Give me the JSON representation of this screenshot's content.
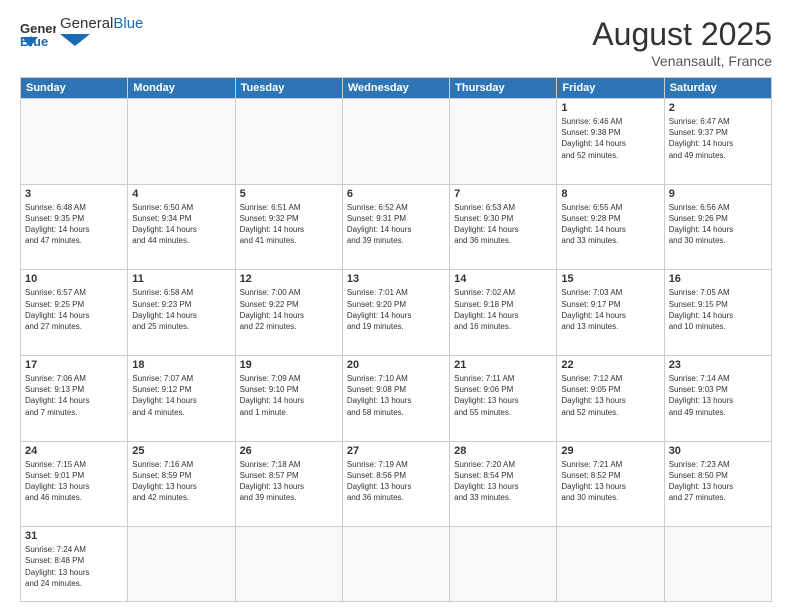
{
  "header": {
    "logo_general": "General",
    "logo_blue": "Blue",
    "month_year": "August 2025",
    "location": "Venansault, France"
  },
  "weekdays": [
    "Sunday",
    "Monday",
    "Tuesday",
    "Wednesday",
    "Thursday",
    "Friday",
    "Saturday"
  ],
  "weeks": [
    [
      {
        "day": "",
        "text": ""
      },
      {
        "day": "",
        "text": ""
      },
      {
        "day": "",
        "text": ""
      },
      {
        "day": "",
        "text": ""
      },
      {
        "day": "",
        "text": ""
      },
      {
        "day": "1",
        "text": "Sunrise: 6:46 AM\nSunset: 9:38 PM\nDaylight: 14 hours\nand 52 minutes."
      },
      {
        "day": "2",
        "text": "Sunrise: 6:47 AM\nSunset: 9:37 PM\nDaylight: 14 hours\nand 49 minutes."
      }
    ],
    [
      {
        "day": "3",
        "text": "Sunrise: 6:48 AM\nSunset: 9:35 PM\nDaylight: 14 hours\nand 47 minutes."
      },
      {
        "day": "4",
        "text": "Sunrise: 6:50 AM\nSunset: 9:34 PM\nDaylight: 14 hours\nand 44 minutes."
      },
      {
        "day": "5",
        "text": "Sunrise: 6:51 AM\nSunset: 9:32 PM\nDaylight: 14 hours\nand 41 minutes."
      },
      {
        "day": "6",
        "text": "Sunrise: 6:52 AM\nSunset: 9:31 PM\nDaylight: 14 hours\nand 39 minutes."
      },
      {
        "day": "7",
        "text": "Sunrise: 6:53 AM\nSunset: 9:30 PM\nDaylight: 14 hours\nand 36 minutes."
      },
      {
        "day": "8",
        "text": "Sunrise: 6:55 AM\nSunset: 9:28 PM\nDaylight: 14 hours\nand 33 minutes."
      },
      {
        "day": "9",
        "text": "Sunrise: 6:56 AM\nSunset: 9:26 PM\nDaylight: 14 hours\nand 30 minutes."
      }
    ],
    [
      {
        "day": "10",
        "text": "Sunrise: 6:57 AM\nSunset: 9:25 PM\nDaylight: 14 hours\nand 27 minutes."
      },
      {
        "day": "11",
        "text": "Sunrise: 6:58 AM\nSunset: 9:23 PM\nDaylight: 14 hours\nand 25 minutes."
      },
      {
        "day": "12",
        "text": "Sunrise: 7:00 AM\nSunset: 9:22 PM\nDaylight: 14 hours\nand 22 minutes."
      },
      {
        "day": "13",
        "text": "Sunrise: 7:01 AM\nSunset: 9:20 PM\nDaylight: 14 hours\nand 19 minutes."
      },
      {
        "day": "14",
        "text": "Sunrise: 7:02 AM\nSunset: 9:18 PM\nDaylight: 14 hours\nand 16 minutes."
      },
      {
        "day": "15",
        "text": "Sunrise: 7:03 AM\nSunset: 9:17 PM\nDaylight: 14 hours\nand 13 minutes."
      },
      {
        "day": "16",
        "text": "Sunrise: 7:05 AM\nSunset: 9:15 PM\nDaylight: 14 hours\nand 10 minutes."
      }
    ],
    [
      {
        "day": "17",
        "text": "Sunrise: 7:06 AM\nSunset: 9:13 PM\nDaylight: 14 hours\nand 7 minutes."
      },
      {
        "day": "18",
        "text": "Sunrise: 7:07 AM\nSunset: 9:12 PM\nDaylight: 14 hours\nand 4 minutes."
      },
      {
        "day": "19",
        "text": "Sunrise: 7:09 AM\nSunset: 9:10 PM\nDaylight: 14 hours\nand 1 minute."
      },
      {
        "day": "20",
        "text": "Sunrise: 7:10 AM\nSunset: 9:08 PM\nDaylight: 13 hours\nand 58 minutes."
      },
      {
        "day": "21",
        "text": "Sunrise: 7:11 AM\nSunset: 9:06 PM\nDaylight: 13 hours\nand 55 minutes."
      },
      {
        "day": "22",
        "text": "Sunrise: 7:12 AM\nSunset: 9:05 PM\nDaylight: 13 hours\nand 52 minutes."
      },
      {
        "day": "23",
        "text": "Sunrise: 7:14 AM\nSunset: 9:03 PM\nDaylight: 13 hours\nand 49 minutes."
      }
    ],
    [
      {
        "day": "24",
        "text": "Sunrise: 7:15 AM\nSunset: 9:01 PM\nDaylight: 13 hours\nand 46 minutes."
      },
      {
        "day": "25",
        "text": "Sunrise: 7:16 AM\nSunset: 8:59 PM\nDaylight: 13 hours\nand 42 minutes."
      },
      {
        "day": "26",
        "text": "Sunrise: 7:18 AM\nSunset: 8:57 PM\nDaylight: 13 hours\nand 39 minutes."
      },
      {
        "day": "27",
        "text": "Sunrise: 7:19 AM\nSunset: 8:56 PM\nDaylight: 13 hours\nand 36 minutes."
      },
      {
        "day": "28",
        "text": "Sunrise: 7:20 AM\nSunset: 8:54 PM\nDaylight: 13 hours\nand 33 minutes."
      },
      {
        "day": "29",
        "text": "Sunrise: 7:21 AM\nSunset: 8:52 PM\nDaylight: 13 hours\nand 30 minutes."
      },
      {
        "day": "30",
        "text": "Sunrise: 7:23 AM\nSunset: 8:50 PM\nDaylight: 13 hours\nand 27 minutes."
      }
    ],
    [
      {
        "day": "31",
        "text": "Sunrise: 7:24 AM\nSunset: 8:48 PM\nDaylight: 13 hours\nand 24 minutes."
      },
      {
        "day": "",
        "text": ""
      },
      {
        "day": "",
        "text": ""
      },
      {
        "day": "",
        "text": ""
      },
      {
        "day": "",
        "text": ""
      },
      {
        "day": "",
        "text": ""
      },
      {
        "day": "",
        "text": ""
      }
    ]
  ]
}
